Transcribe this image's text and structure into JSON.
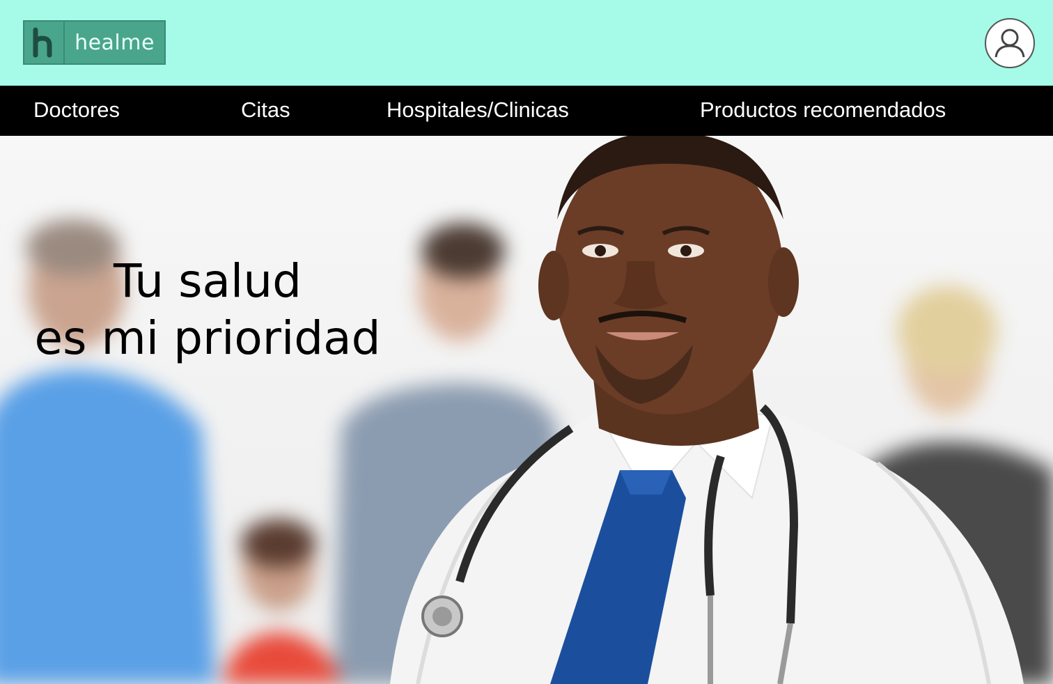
{
  "header": {
    "logo_text": "healme",
    "logo_mark": "h",
    "profile_icon": "user-icon"
  },
  "nav": {
    "items": [
      {
        "label": "Doctores"
      },
      {
        "label": "Citas"
      },
      {
        "label": "Hospitales/Clinicas"
      },
      {
        "label": "Productos recomendados"
      }
    ]
  },
  "hero": {
    "line1": "Tu salud",
    "line2": "es mi prioridad",
    "image": "doctor-with-stethoscope-photo"
  },
  "colors": {
    "header_bg": "#a5fbe8",
    "logo_bg": "#49a58c",
    "nav_bg": "#000000",
    "nav_text": "#ffffff"
  }
}
